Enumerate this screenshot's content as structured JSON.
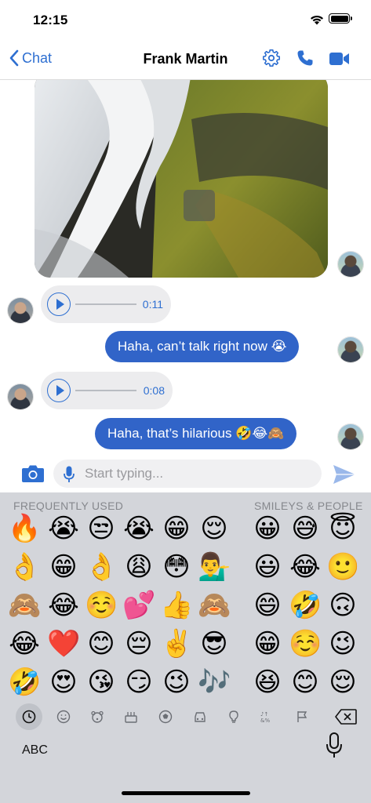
{
  "status": {
    "time": "12:15"
  },
  "nav": {
    "back_label": "Chat",
    "title": "Frank Martin"
  },
  "messages": {
    "audio1_duration": "0:11",
    "outgoing1": "Haha, can’t talk right now 😭",
    "audio2_duration": "0:08",
    "outgoing2": "Haha, that’s hilarious 🤣😂🙈"
  },
  "input": {
    "placeholder": "Start typing..."
  },
  "keyboard": {
    "section_frequent": "FREQUENTLY USED",
    "section_smileys": "SMILEYS & PEOPLE",
    "abc_label": "ABC",
    "frequent_emojis": [
      [
        "🔥",
        "😭",
        "😒",
        "😭",
        "😁",
        "😌"
      ],
      [
        "👌",
        "😁",
        "👌",
        "😩",
        "😳",
        "💁‍♂️"
      ],
      [
        "🙈",
        "😂",
        "☺️",
        "💕",
        "👍",
        "🙈"
      ],
      [
        "😂",
        "❤️",
        "😊",
        "😔",
        "✌️",
        "😎"
      ],
      [
        "🤣",
        "😍",
        "😘",
        "😏",
        "😉",
        "🎶"
      ]
    ],
    "smiley_emojis": [
      [
        "😀",
        "😅",
        "😇"
      ],
      [
        "😃",
        "😂",
        "🙂"
      ],
      [
        "😄",
        "🤣",
        "🙃"
      ],
      [
        "😁",
        "☺️",
        "😉"
      ],
      [
        "😆",
        "😊",
        "😌"
      ]
    ],
    "categories": [
      "clock-icon",
      "smiley-icon",
      "animal-icon",
      "food-icon",
      "ball-icon",
      "car-icon",
      "bulb-icon",
      "symbols-icon",
      "flag-icon",
      "delete-icon"
    ]
  },
  "colors": {
    "accent": "#2e6fd1",
    "bubble_out": "#3164c8",
    "bubble_in": "#ececee",
    "keyboard_bg": "#d3d5da"
  }
}
